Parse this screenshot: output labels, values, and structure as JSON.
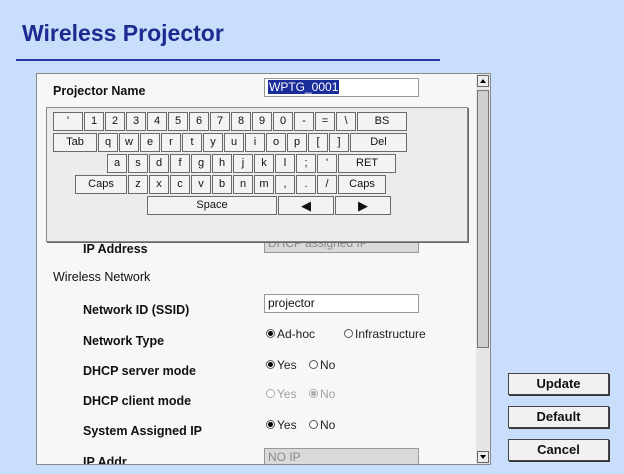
{
  "title": "Wireless Projector",
  "form": {
    "projector_name_label": "Projector Name",
    "projector_name_value": "WPTG_0001",
    "ip_address_label": "IP Address",
    "ip_address_value": "DHCP assigned IP",
    "wireless_network_label": "Wireless Network",
    "network_id_label": "Network ID (SSID)",
    "network_id_value": "projector",
    "network_type_label": "Network Type",
    "network_type_options": [
      "Ad-hoc",
      "Infrastructure"
    ],
    "network_type_selected": "Ad-hoc",
    "dhcp_server_label": "DHCP server mode",
    "dhcp_server_yes": "Yes",
    "dhcp_server_no": "No",
    "dhcp_client_label": "DHCP client mode",
    "dhcp_client_yes": "Yes",
    "dhcp_client_no": "No",
    "system_ip_label": "System Assigned IP",
    "system_ip_yes": "Yes",
    "system_ip_no": "No",
    "partial_label": "IP Addr...",
    "partial_value": "NO IP"
  },
  "keyboard": {
    "row1": [
      "'",
      "1",
      "2",
      "3",
      "4",
      "5",
      "6",
      "7",
      "8",
      "9",
      "0",
      "-",
      "=",
      "\\",
      "BS"
    ],
    "row2": [
      "Tab",
      "q",
      "w",
      "e",
      "r",
      "t",
      "y",
      "u",
      "i",
      "o",
      "p",
      "[",
      "]",
      "Del"
    ],
    "row3": [
      "a",
      "s",
      "d",
      "f",
      "g",
      "h",
      "j",
      "k",
      "l",
      ";",
      "'",
      "RET"
    ],
    "row4": [
      "Caps",
      "z",
      "x",
      "c",
      "v",
      "b",
      "n",
      "m",
      ",",
      ".",
      "/",
      "Caps"
    ],
    "space": "Space",
    "left_arrow": "◀",
    "right_arrow": "▶"
  },
  "buttons": {
    "update": "Update",
    "default": "Default",
    "cancel": "Cancel"
  }
}
